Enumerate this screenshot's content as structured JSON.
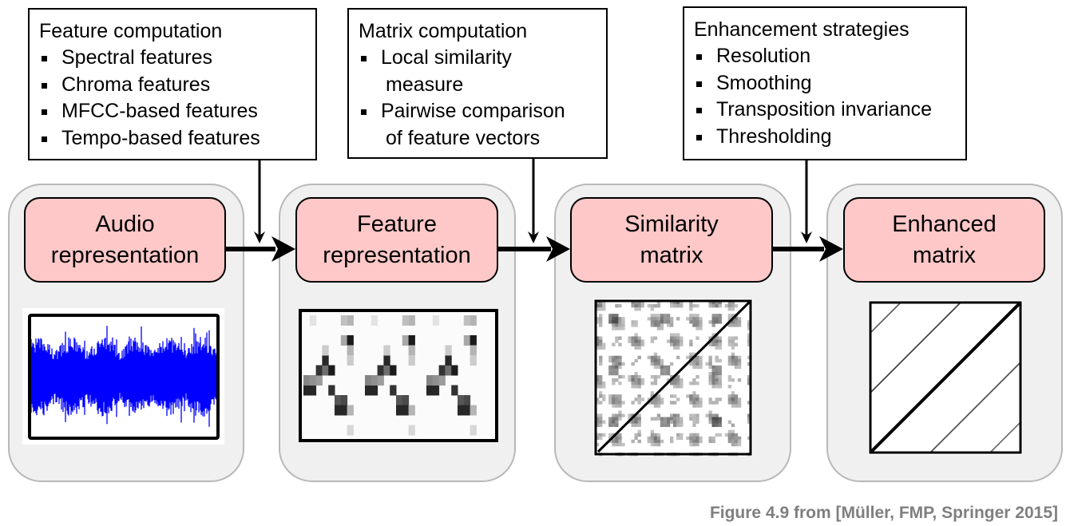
{
  "info_boxes": [
    {
      "title": "Feature computation",
      "items": [
        {
          "line1": "Spectral features",
          "line2": ""
        },
        {
          "line1": "Chroma features",
          "line2": ""
        },
        {
          "line1": "MFCC-based features",
          "line2": ""
        },
        {
          "line1": "Tempo-based features",
          "line2": ""
        }
      ]
    },
    {
      "title": "Matrix computation",
      "items": [
        {
          "line1": "Local similarity",
          "line2": "measure"
        },
        {
          "line1": "Pairwise comparison",
          "line2": "of feature vectors"
        }
      ]
    },
    {
      "title": "Enhancement strategies",
      "items": [
        {
          "line1": "Resolution",
          "line2": ""
        },
        {
          "line1": "Smoothing",
          "line2": ""
        },
        {
          "line1": "Transposition invariance",
          "line2": ""
        },
        {
          "line1": "Thresholding",
          "line2": ""
        }
      ]
    }
  ],
  "stages": [
    {
      "title_line1": "Audio",
      "title_line2": "representation",
      "image": "waveform"
    },
    {
      "title_line1": "Feature",
      "title_line2": "representation",
      "image": "chromagram"
    },
    {
      "title_line1": "Similarity",
      "title_line2": "matrix",
      "image": "self-similarity-matrix"
    },
    {
      "title_line1": "Enhanced",
      "title_line2": "matrix",
      "image": "enhanced-self-similarity-matrix"
    }
  ],
  "caption": "Figure 4.9 from [Müller, FMP, Springer 2015]",
  "colors": {
    "stage_bg": "#f0f0f0",
    "stage_border": "#b8b8b8",
    "title_bg": "#ffc8c8",
    "waveform": "#0000ff",
    "caption": "#7f7f7f"
  }
}
